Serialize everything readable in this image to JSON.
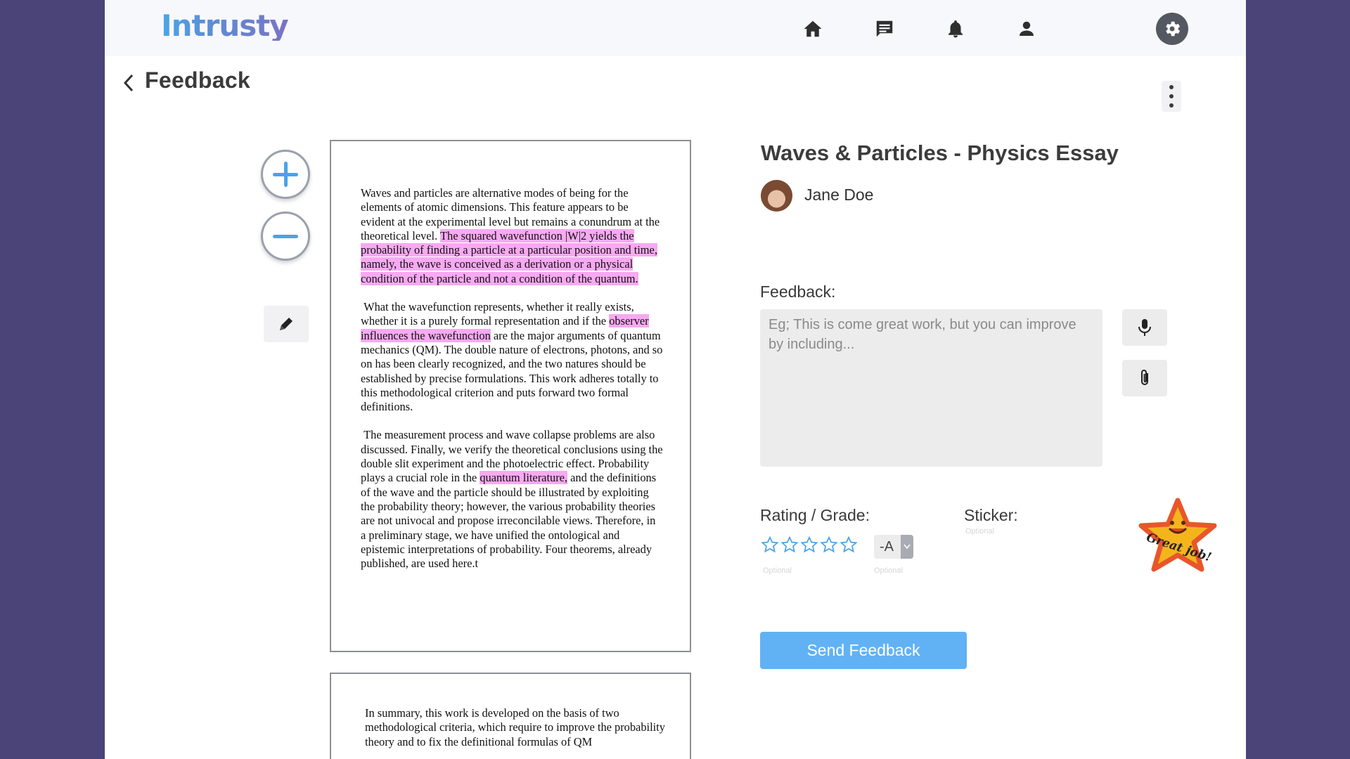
{
  "app": {
    "logo": "Intrusty"
  },
  "header": {
    "nav": [
      {
        "name": "home-icon"
      },
      {
        "name": "messages-icon"
      },
      {
        "name": "bell-icon"
      },
      {
        "name": "user-icon"
      },
      {
        "name": "gear-icon"
      }
    ]
  },
  "page": {
    "title": "Feedback"
  },
  "document": {
    "page1": {
      "p1": {
        "before": "Waves and particles are alternative modes of being for the elements of atomic dimensions. This feature appears to be evident at the experimental level but remains a conundrum at the theoretical level. ",
        "highlight": "The squared wavefunction |W|2 yields the probability of finding a particle at a particular position and time, namely, the wave is conceived as a derivation or a physical condition of the particle and not a condition of the quantum.",
        "after": ""
      },
      "p2": {
        "before": "What the wavefunction represents, whether it really exists, whether it is a purely formal representation and if the ",
        "highlight": "observer influences the wavefunction",
        "after": " are the major arguments of quantum mechanics (QM). The double nature of electrons, photons, and so on has been clearly recognized, and the two natures should be established by precise formulations. This work adheres totally to this methodological criterion and puts forward two formal definitions."
      },
      "p3": {
        "before": "The measurement process and wave collapse problems are also discussed. Finally, we verify the theoretical conclusions using the double slit experiment and the photoelectric effect. Probability plays a crucial role in the ",
        "highlight": "quantum literature,",
        "after": " and the definitions of the wave and the particle should be illustrated by exploiting the probability theory; however, the various probability theories are not univocal and propose irreconcilable views. Therefore, in a preliminary stage, we have unified the ontological and epistemic interpretations of probability. Four theorems, already published, are used here.t"
      }
    },
    "page2": {
      "p1": "In summary, this work is developed on the basis of two methodological criteria, which require to improve the probability theory and to fix the definitional formulas of QM"
    }
  },
  "essay": {
    "title": "Waves & Particles - Physics Essay",
    "student": "Jane Doe"
  },
  "feedback": {
    "label": "Feedback:",
    "placeholder": "Eg; This is come great work, but you can improve by including...",
    "value": ""
  },
  "rating": {
    "label": "Rating / Grade:",
    "stars": 0,
    "max_stars": 5,
    "optional": "Optional",
    "grade": "-A",
    "grade_optional": "Optional"
  },
  "sticker": {
    "label": "Sticker:",
    "optional": "Optional",
    "text": "Great job!"
  },
  "actions": {
    "send": "Send Feedback"
  },
  "colors": {
    "accent": "#61b2f4",
    "highlight": "#f7a9f1",
    "background": "#4a4478"
  }
}
